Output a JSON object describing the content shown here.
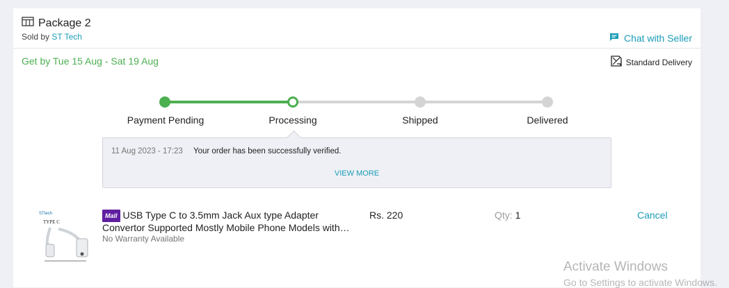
{
  "package": {
    "title": "Package 2",
    "sold_by_prefix": "Sold by",
    "seller": "ST Tech",
    "chat_label": "Chat with Seller",
    "eta": "Get by Tue 15 Aug - Sat 19 Aug",
    "delivery_type": "Standard Delivery"
  },
  "tracker": {
    "steps": [
      {
        "label": "Payment Pending",
        "state": "done"
      },
      {
        "label": "Processing",
        "state": "current"
      },
      {
        "label": "Shipped",
        "state": "pending"
      },
      {
        "label": "Delivered",
        "state": "pending"
      }
    ],
    "colors": {
      "active": "#4caf50",
      "inactive": "#d4d4d4"
    }
  },
  "status": {
    "timestamp": "11 Aug 2023 - 17:23",
    "message": "Your order has been successfully verified.",
    "view_more": "VIEW MORE"
  },
  "item": {
    "badge": "Mall",
    "name_line1": "USB Type C to 3.5mm Jack Aux type Adapter",
    "name_line2": "Convertor Supported Mostly Mobile Phone Models with…",
    "warranty": "No Warranty Available",
    "price": "Rs. 220",
    "qty_label": "Qty:",
    "qty_value": "1",
    "cancel_label": "Cancel",
    "thumb_brand": "STtech",
    "thumb_text": "TYPE C"
  },
  "watermark": {
    "title": "Activate Windows",
    "subtitle": "Go to Settings to activate Windows."
  }
}
